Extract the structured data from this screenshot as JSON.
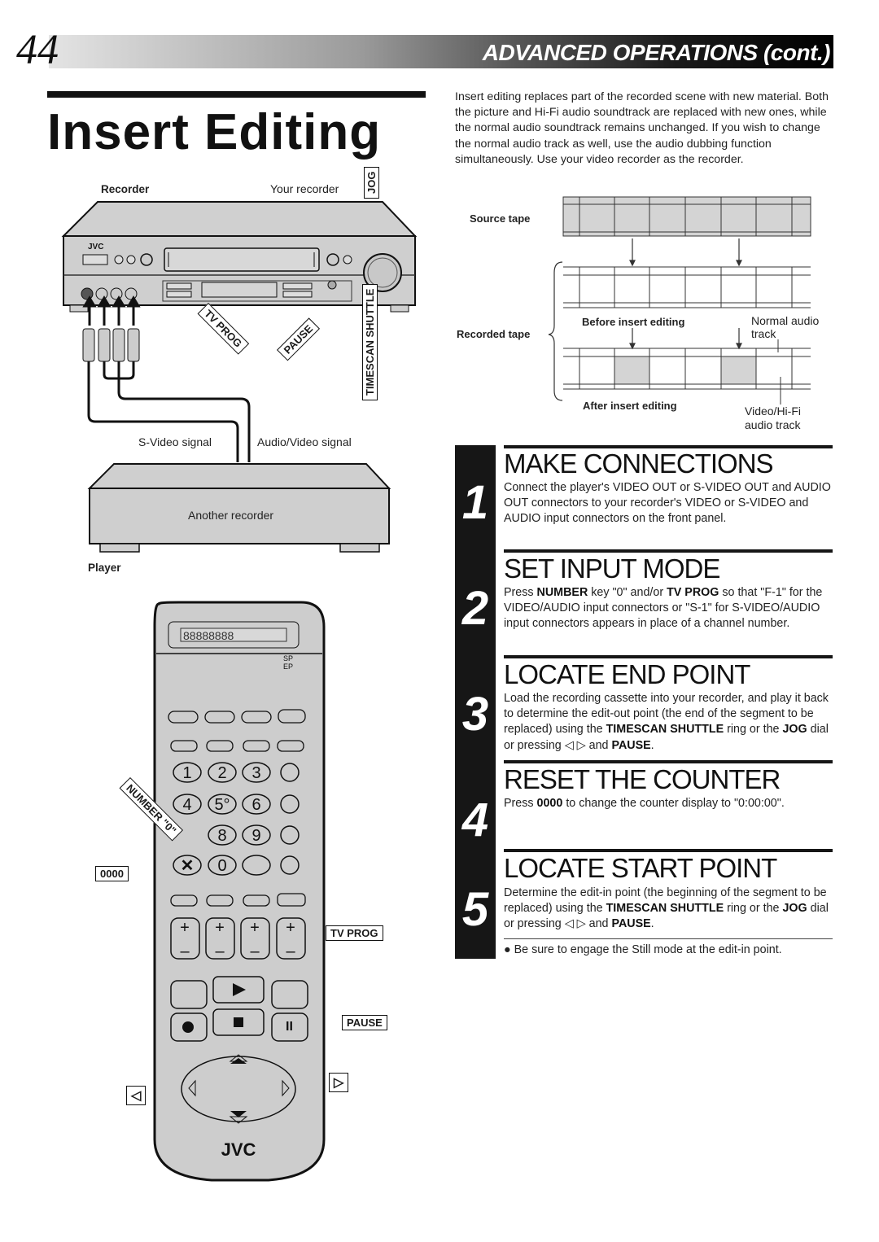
{
  "header": {
    "page_number": "44",
    "section": "ADVANCED OPERATIONS",
    "section_suffix": "(cont.)"
  },
  "title": "Insert Editing",
  "intro": "Insert editing replaces part of the recorded scene with new material. Both the picture and Hi-Fi audio soundtrack are replaced with new ones, while the normal audio soundtrack remains unchanged. If you wish to change the normal audio track as well, use the audio dubbing function simultaneously. Use your video recorder as the recorder.",
  "connection_figure": {
    "recorder_label": "Recorder",
    "your_recorder_label": "Your recorder",
    "brand": "JVC",
    "jog_tag": "JOG",
    "tv_prog_tag": "TV PROG",
    "pause_tag": "PAUSE",
    "timescan_tag": "TIMESCAN SHUTTLE",
    "svideo_signal": "S-Video signal",
    "av_signal": "Audio/Video signal",
    "another_recorder": "Another recorder",
    "player_label": "Player"
  },
  "remote_figure": {
    "display_mode_sp": "SP",
    "display_mode_ep": "EP",
    "number_tag": "NUMBER \"0\"",
    "zero_tag": "0000",
    "tv_prog_tag": "TV PROG",
    "pause_tag": "PAUSE",
    "left_tag": "◁",
    "right_tag": "▷",
    "keys": [
      "1",
      "2",
      "3",
      "4",
      "5°",
      "6",
      "8",
      "9",
      "0"
    ],
    "brand": "JVC"
  },
  "tape_figure": {
    "source_tape": "Source tape",
    "recorded_tape": "Recorded tape",
    "before": "Before insert editing",
    "after": "After insert editing",
    "normal_audio_line1": "Normal audio",
    "normal_audio_line2": "track",
    "video_hifi_line1": "Video/Hi-Fi",
    "video_hifi_line2": "audio track"
  },
  "steps": [
    {
      "number": "1",
      "title": "MAKE CONNECTIONS",
      "body": "Connect the player's VIDEO OUT or S-VIDEO OUT and AUDIO OUT connectors to your recorder's VIDEO or S-VIDEO and AUDIO input connectors on the front panel."
    },
    {
      "number": "2",
      "title": "SET INPUT MODE",
      "body_parts": [
        "Press ",
        "NUMBER",
        " key \"0\" and/or ",
        "TV PROG",
        " so that \"F-1\" for the VIDEO/AUDIO input connectors or \"S-1\" for S-VIDEO/AUDIO input connectors appears in place of a channel number."
      ]
    },
    {
      "number": "3",
      "title": "LOCATE END POINT",
      "body_parts": [
        "Load the recording cassette into your recorder, and play it back to determine the edit-out point (the end of the segment to be replaced) using the ",
        "TIMESCAN SHUTTLE",
        " ring or the ",
        "JOG",
        " dial or pressing ◁ ▷ and ",
        "PAUSE",
        "."
      ]
    },
    {
      "number": "4",
      "title": "RESET THE COUNTER",
      "body_parts": [
        "Press ",
        "0000",
        " to change the counter display to \"0:00:00\"."
      ]
    },
    {
      "number": "5",
      "title": "LOCATE START POINT",
      "body_parts": [
        "Determine the edit-in point (the beginning of the segment to be replaced) using the ",
        "TIMESCAN SHUTTLE",
        " ring or the ",
        "JOG",
        " dial or pressing ◁ ▷ and ",
        "PAUSE",
        "."
      ],
      "note": "● Be sure to engage the Still mode at the edit-in point."
    }
  ],
  "colors": {
    "ink": "#111111",
    "device_gray": "#cfcfcf",
    "tape_fill": "#d4d4d4"
  }
}
